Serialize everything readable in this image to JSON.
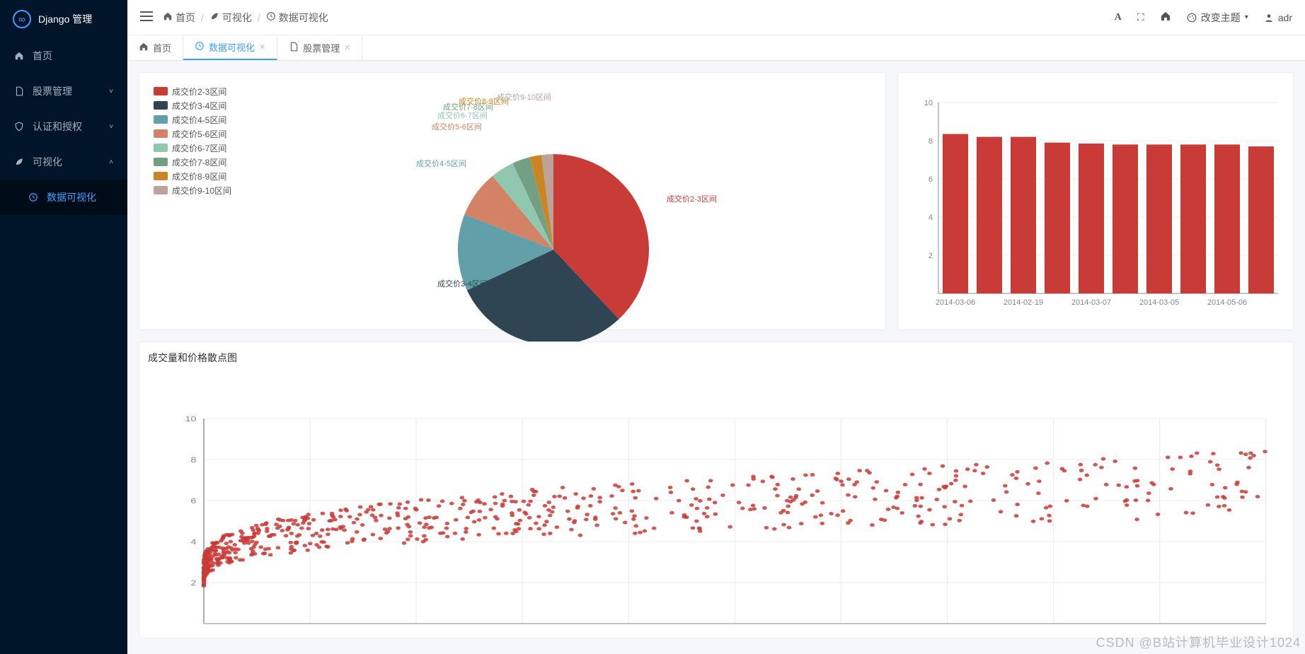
{
  "brand": "Django 管理",
  "sidebar": {
    "items": [
      {
        "icon": "home",
        "label": "首页"
      },
      {
        "icon": "file",
        "label": "股票管理",
        "chev": "down"
      },
      {
        "icon": "shield",
        "label": "认证和授权",
        "chev": "down"
      },
      {
        "icon": "leaf",
        "label": "可视化",
        "chev": "up"
      },
      {
        "icon": "clock",
        "label": "数据可视化",
        "sub": true,
        "active": true
      }
    ]
  },
  "breadcrumb": [
    {
      "icon": "home",
      "label": "首页"
    },
    {
      "icon": "leaf",
      "label": "可视化"
    },
    {
      "icon": "clock",
      "label": "数据可视化"
    }
  ],
  "topbar": {
    "theme_label": "改变主题",
    "user": "adr"
  },
  "tabs": [
    {
      "icon": "home",
      "label": "首页",
      "closable": false
    },
    {
      "icon": "clock",
      "label": "数据可视化",
      "closable": true,
      "active": true
    },
    {
      "icon": "file",
      "label": "股票管理",
      "closable": true
    }
  ],
  "scatter_title": "成交量和价格散点图",
  "watermark": "CSDN @B站计算机毕业设计1024",
  "chart_data": [
    {
      "type": "pie",
      "title": "",
      "series": [
        {
          "name": "成交价2-3区间",
          "value": 38,
          "color": "#c83b36"
        },
        {
          "name": "成交价3-4区间",
          "value": 30,
          "color": "#2f4554"
        },
        {
          "name": "成交价4-5区间",
          "value": 13,
          "color": "#61a0a8"
        },
        {
          "name": "成交价5-6区间",
          "value": 8,
          "color": "#d48265"
        },
        {
          "name": "成交价6-7区间",
          "value": 4,
          "color": "#91c7ae"
        },
        {
          "name": "成交价7-8区间",
          "value": 3,
          "color": "#749f83"
        },
        {
          "name": "成交价8-9区间",
          "value": 2,
          "color": "#ca8622"
        },
        {
          "name": "成交价9-10区间",
          "value": 2,
          "color": "#bda29a"
        }
      ],
      "label_lines": [
        {
          "name": "成交价2-3区间",
          "color": "#c83b36",
          "x": 300,
          "y": 170
        },
        {
          "name": "成交价3-4区间",
          "color": "#2f4554",
          "x": -24,
          "y": 290
        },
        {
          "name": "成交价4-5区间",
          "color": "#61a0a8",
          "x": -54,
          "y": 120
        },
        {
          "name": "成交价5-6区间",
          "color": "#d48265",
          "x": -32,
          "y": 68
        },
        {
          "name": "成交价6-7区间",
          "color": "#91c7ae",
          "x": -24,
          "y": 52
        },
        {
          "name": "成交价7-8区间",
          "color": "#749f83",
          "x": -16,
          "y": 40
        },
        {
          "name": "成交价8-9区间",
          "color": "#ca8622",
          "x": 6,
          "y": 32
        },
        {
          "name": "成交价9-10区间",
          "color": "#bda29a",
          "x": 60,
          "y": 26
        }
      ]
    },
    {
      "type": "bar",
      "title": "",
      "ylim": [
        0,
        10
      ],
      "yticks": [
        2,
        4,
        6,
        8,
        10
      ],
      "categories": [
        "2014-03-06",
        "",
        "2014-02-19",
        "",
        "2014-03-07",
        "",
        "2014-03-05",
        "",
        "2014-05-06",
        ""
      ],
      "values": [
        8.35,
        8.2,
        8.2,
        7.9,
        7.85,
        7.8,
        7.8,
        7.8,
        7.8,
        7.7
      ],
      "color": "#c83b36"
    },
    {
      "type": "scatter",
      "title": "成交量和价格散点图",
      "ylim": [
        0,
        10
      ],
      "yticks": [
        2,
        4,
        6,
        8,
        10
      ],
      "xlim": [
        0,
        1000
      ],
      "color": "#c83b36",
      "points_note": "dense cloud near x 0-120 y 2-5, spreading sparsely to x 900 y 3-8"
    }
  ]
}
